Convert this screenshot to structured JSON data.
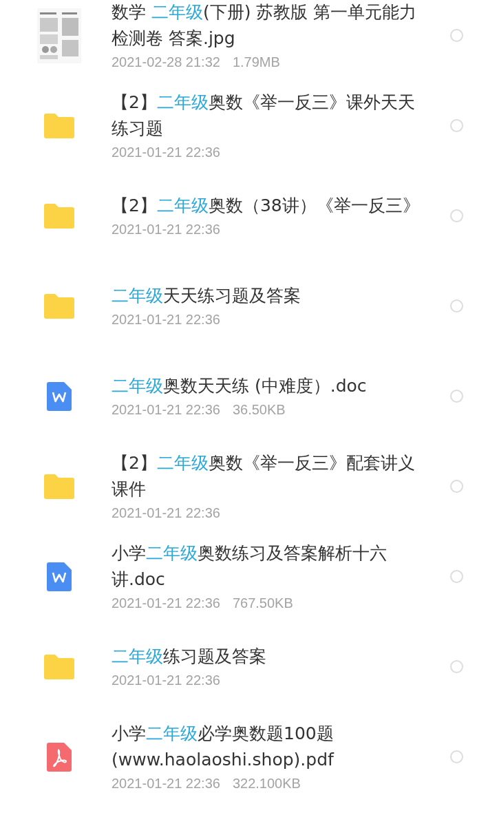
{
  "files": [
    {
      "title": [
        {
          "text": "数学 ",
          "highlight": false
        },
        {
          "text": "二年级",
          "highlight": true
        },
        {
          "text": "(下册) 苏教版 第一单元能力检测卷 答案.jpg",
          "highlight": false
        }
      ],
      "date": "2021-02-28 21:32",
      "size": "1.79MB",
      "selected": false
    },
    {
      "kind": "folder",
      "title": [
        {
          "text": "【2】",
          "highlight": false
        },
        {
          "text": "二年级",
          "highlight": true
        },
        {
          "text": "奥数《举一反三》课外天天练习题",
          "highlight": false
        }
      ],
      "date": "2021-01-21 22:36",
      "selected": false
    },
    {
      "kind": "folder",
      "title": [
        {
          "text": "【2】",
          "highlight": false
        },
        {
          "text": "二年级",
          "highlight": true
        },
        {
          "text": "奥数（38讲）《举一反三》",
          "highlight": false
        }
      ],
      "date": "2021-01-21 22:36",
      "selected": false
    },
    {
      "kind": "folder",
      "title": [
        {
          "text": "二年级",
          "highlight": true
        },
        {
          "text": "天天练习题及答案",
          "highlight": false
        }
      ],
      "date": "2021-01-21 22:36",
      "selected": false
    },
    {
      "kind": "word",
      "title": [
        {
          "text": "二年级",
          "highlight": true
        },
        {
          "text": "奥数天天练 (中难度）.doc",
          "highlight": false
        }
      ],
      "date": "2021-01-21 22:36",
      "size": "36.50KB",
      "selected": false
    },
    {
      "kind": "folder",
      "title": [
        {
          "text": "【2】",
          "highlight": false
        },
        {
          "text": "二年级",
          "highlight": true
        },
        {
          "text": "奥数《举一反三》配套讲义课件",
          "highlight": false
        }
      ],
      "date": "2021-01-21 22:36",
      "selected": false
    },
    {
      "kind": "word",
      "title": [
        {
          "text": "小学",
          "highlight": false
        },
        {
          "text": "二年级",
          "highlight": true
        },
        {
          "text": "奥数练习及答案解析十六讲.doc",
          "highlight": false
        }
      ],
      "date": "2021-01-21 22:36",
      "size": "767.50KB",
      "selected": false
    },
    {
      "kind": "folder",
      "title": [
        {
          "text": "二年级",
          "highlight": true
        },
        {
          "text": "练习题及答案",
          "highlight": false
        }
      ],
      "date": "2021-01-21 22:36",
      "selected": false
    },
    {
      "kind": "pdf",
      "title": [
        {
          "text": "小学",
          "highlight": false
        },
        {
          "text": "二年级",
          "highlight": true
        },
        {
          "text": "必学奥数题100题(www.haolaoshi.shop).pdf",
          "highlight": false
        }
      ],
      "date": "2021-01-21 22:36",
      "size": "322.100KB",
      "selected": false
    }
  ]
}
